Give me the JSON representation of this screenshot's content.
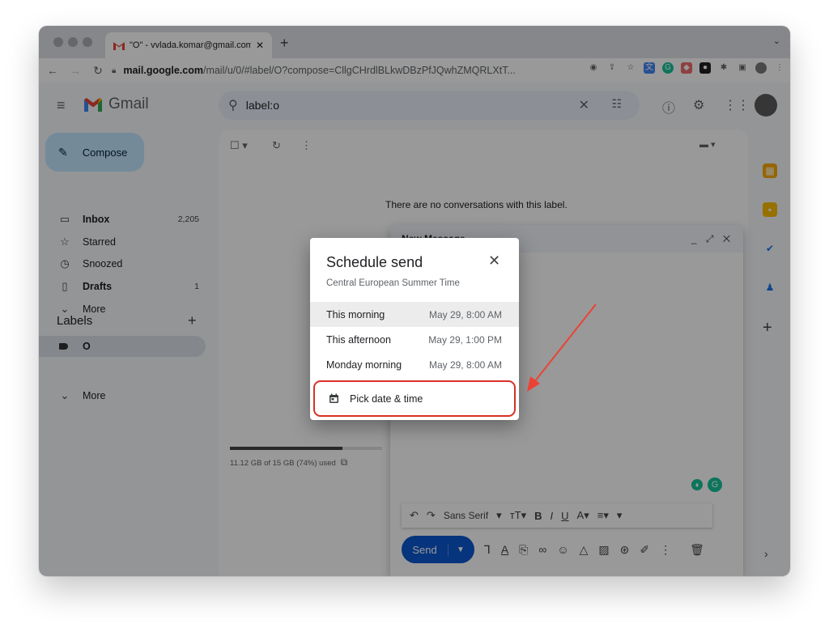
{
  "browser": {
    "tab_title": "\"O\" - vvlada.komar@gmail.com",
    "tab_close": "✕",
    "new_tab": "+",
    "url_host": "mail.google.com",
    "url_path": "/mail/u/0/#label/O?compose=CllgCHrdlBLkwDBzPfJQwhZMQRLXtT..."
  },
  "gmail": {
    "app_name": "Gmail",
    "search_query": "label:o",
    "compose_label": "Compose",
    "sidebar": {
      "items": [
        {
          "label": "Inbox",
          "count": "2,205",
          "icon": "inbox-icon"
        },
        {
          "label": "Starred",
          "count": "",
          "icon": "star-icon"
        },
        {
          "label": "Snoozed",
          "count": "",
          "icon": "clock-icon"
        },
        {
          "label": "Drafts",
          "count": "1",
          "icon": "draft-icon"
        },
        {
          "label": "More",
          "count": "",
          "icon": "chevron-down-icon"
        }
      ],
      "labels_heading": "Labels",
      "labels_add": "+",
      "label_o": "O",
      "labels_more": "More"
    },
    "main": {
      "empty_text": "There are no conversations with this label.",
      "storage_text": "11.12 GB of 15 GB (74%) used",
      "storage_fraction": 0.74
    },
    "new_message": {
      "title": "New Message",
      "controls": "_ ⤢ ✕",
      "font_family": "Sans Serif",
      "send_label": "Send"
    }
  },
  "schedule_dialog": {
    "title": "Schedule send",
    "timezone": "Central European Summer Time",
    "close": "✕",
    "options": [
      {
        "label": "This morning",
        "when": "May 29, 8:00 AM"
      },
      {
        "label": "This afternoon",
        "when": "May 29, 1:00 PM"
      },
      {
        "label": "Monday morning",
        "when": "May 29, 8:00 AM"
      }
    ],
    "pick_label": "Pick date & time"
  },
  "colors": {
    "accent": "#0b57d0",
    "highlight_box": "#d93025",
    "arrow": "#ea4335",
    "compose_bg": "#c2e7ff"
  }
}
